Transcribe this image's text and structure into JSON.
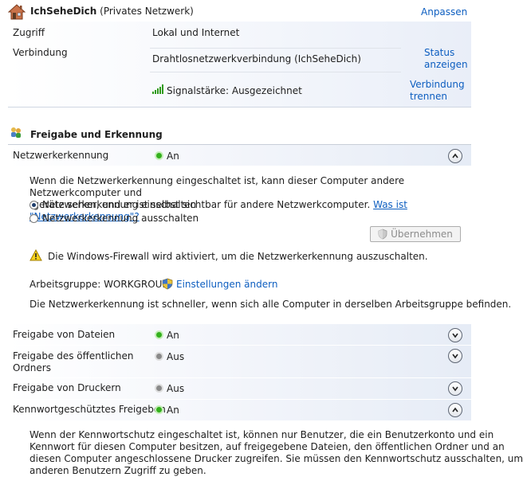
{
  "network": {
    "name": "IchSeheDich",
    "type": "(Privates Netzwerk)",
    "customize_link": "Anpassen",
    "access_label": "Zugriff",
    "access_value": "Lokal und Internet",
    "connection_label": "Verbindung",
    "connection_value": "Drahtlosnetzwerkverbindung (IchSeheDich)",
    "status_link_1": "Status",
    "status_link_2": "anzeigen",
    "signal_text": "Signalstärke: Ausgezeichnet",
    "disconnect_link_1": "Verbindung",
    "disconnect_link_2": "trennen"
  },
  "sharing": {
    "title": "Freigabe und Erkennung",
    "discovery": {
      "label": "Netzwerkerkennung",
      "status": "An",
      "desc_1": "Wenn die Netzwerkerkennung eingeschaltet ist, kann dieser Computer andere Netzwerkcomputer und",
      "desc_2": "-geräte sehen, und er ist selbst sichtbar für andere Netzwerkcomputer.",
      "help_link": "Was ist \"Netzwerkerkennung\"?",
      "option_on": "Netzwerkerkennung einschalten",
      "option_off": "Netzwerkerkennung ausschalten",
      "apply_button": "Übernehmen",
      "warning": "Die Windows-Firewall wird aktiviert, um die Netzwerkerkennung auszuschalten.",
      "workgroup_label": "Arbeitsgruppe: WORKGROUP",
      "change_settings_link": "Einstellungen ändern",
      "workgroup_note": "Die Netzwerkerkennung ist schneller, wenn sich alle Computer in derselben Arbeitsgruppe befinden."
    },
    "rows": [
      {
        "label": "Freigabe von Dateien",
        "status": "An"
      },
      {
        "label_1": "Freigabe des öffentlichen",
        "label_2": "Ordners",
        "status": "Aus"
      },
      {
        "label": "Freigabe von Druckern",
        "status": "Aus"
      },
      {
        "label": "Kennwortgeschütztes Freigeben",
        "status": "An"
      }
    ],
    "password_desc": [
      "Wenn der Kennwortschutz eingeschaltet ist, können nur Benutzer, die ein Benutzerkonto und ein",
      "Kennwort für diesen Computer besitzen, auf freigegebene Dateien, den öffentlichen Ordner und an",
      "diesen Computer angeschlossene Drucker zugreifen. Sie müssen den Kennwortschutz ausschalten, um",
      "anderen Benutzern Zugriff zu geben."
    ]
  },
  "colors": {
    "link": "#0d5ec0",
    "status_on": "#34b11d",
    "status_off": "#8a8a8a"
  }
}
